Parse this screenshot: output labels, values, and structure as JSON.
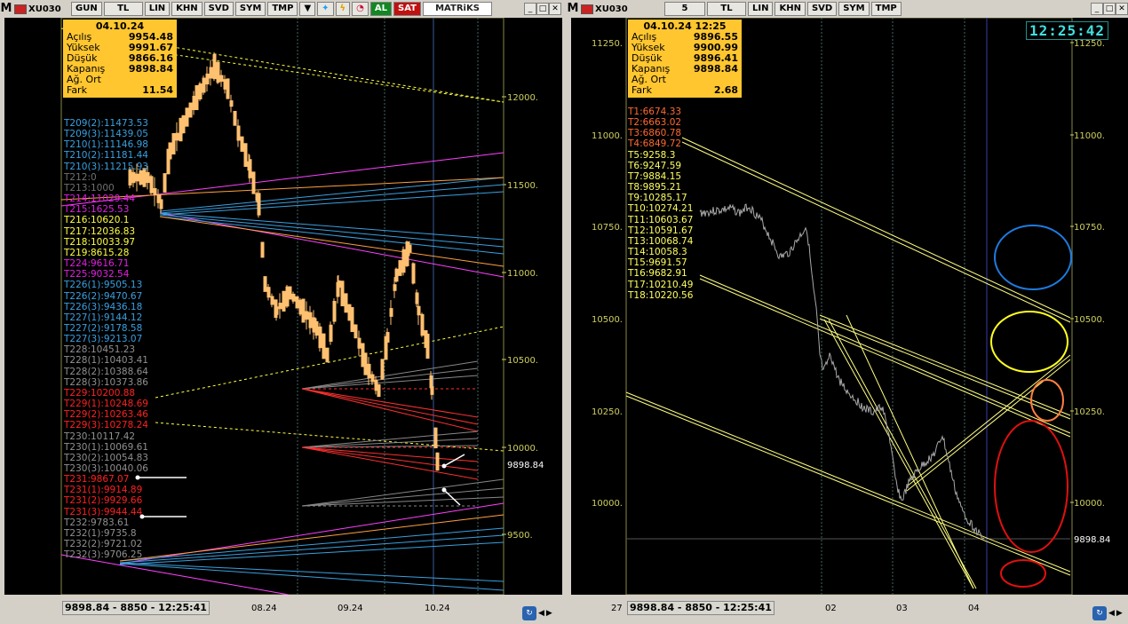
{
  "left": {
    "toolbar": {
      "m": "M",
      "symbol": "XU030",
      "period": "GUN",
      "currency": "TL",
      "btn_lin": "LIN",
      "btn_khn": "KHN",
      "btn_svd": "SVD",
      "btn_sym": "SYM",
      "btn_tmp": "TMP",
      "btn_al": "AL",
      "btn_sat": "SAT",
      "brand": "MATRiKS"
    },
    "ohlc": {
      "date": "04.10.24",
      "rows": [
        {
          "k": "Açılış",
          "v": "9954.48"
        },
        {
          "k": "Yüksek",
          "v": "9991.67"
        },
        {
          "k": "Düşük",
          "v": "9866.16"
        },
        {
          "k": "Kapanış",
          "v": "9898.84"
        },
        {
          "k": "Ağ. Ort",
          "v": ""
        },
        {
          "k": "Fark",
          "v": "11.54"
        }
      ]
    },
    "levels": [
      {
        "t": "T209(2):11473.53",
        "c": "#3aa0e0"
      },
      {
        "t": "T209(3):11439.05",
        "c": "#3aa0e0"
      },
      {
        "t": "T210(1):11146.98",
        "c": "#3aa0e0"
      },
      {
        "t": "T210(2):11181.44",
        "c": "#3aa0e0"
      },
      {
        "t": "T210(3):11215.93",
        "c": "#3aa0e0"
      },
      {
        "t": "T212:0",
        "c": "#707070"
      },
      {
        "t": "T213:1000",
        "c": "#707070"
      },
      {
        "t": "T214:11029.44",
        "c": "#e020e0"
      },
      {
        "t": "T215:1625.53",
        "c": "#e020e0"
      },
      {
        "t": "T216:10620.1",
        "c": "#ffff40"
      },
      {
        "t": "T217:12036.83",
        "c": "#ffff40"
      },
      {
        "t": "T218:10033.97",
        "c": "#ffff40"
      },
      {
        "t": "T219:8615.28",
        "c": "#ffff40"
      },
      {
        "t": "T224:9616.71",
        "c": "#e020e0"
      },
      {
        "t": "T225:9032.54",
        "c": "#e020e0"
      },
      {
        "t": "T226(1):9505.13",
        "c": "#3aa0e0"
      },
      {
        "t": "T226(2):9470.67",
        "c": "#3aa0e0"
      },
      {
        "t": "T226(3):9436.18",
        "c": "#3aa0e0"
      },
      {
        "t": "T227(1):9144.12",
        "c": "#3aa0e0"
      },
      {
        "t": "T227(2):9178.58",
        "c": "#3aa0e0"
      },
      {
        "t": "T227(3):9213.07",
        "c": "#3aa0e0"
      },
      {
        "t": "T228:10451.23",
        "c": "#909090"
      },
      {
        "t": "T228(1):10403.41",
        "c": "#909090"
      },
      {
        "t": "T228(2):10388.64",
        "c": "#909090"
      },
      {
        "t": "T228(3):10373.86",
        "c": "#909090"
      },
      {
        "t": "T229:10200.88",
        "c": "#ff2020"
      },
      {
        "t": "T229(1):10248.69",
        "c": "#ff2020"
      },
      {
        "t": "T229(2):10263.46",
        "c": "#ff2020"
      },
      {
        "t": "T229(3):10278.24",
        "c": "#ff2020"
      },
      {
        "t": "T230:10117.42",
        "c": "#909090"
      },
      {
        "t": "T230(1):10069.61",
        "c": "#909090"
      },
      {
        "t": "T230(2):10054.83",
        "c": "#909090"
      },
      {
        "t": "T230(3):10040.06",
        "c": "#909090"
      },
      {
        "t": "T231:9867.07",
        "c": "#ff2020"
      },
      {
        "t": "T231(1):9914.89",
        "c": "#ff2020"
      },
      {
        "t": "T231(2):9929.66",
        "c": "#ff2020"
      },
      {
        "t": "T231(3):9944.44",
        "c": "#ff2020"
      },
      {
        "t": "T232:9783.61",
        "c": "#909090"
      },
      {
        "t": "T232(1):9735.8",
        "c": "#909090"
      },
      {
        "t": "T232(2):9721.02",
        "c": "#909090"
      },
      {
        "t": "T232(3):9706.25",
        "c": "#909090"
      }
    ],
    "yaxis": [
      "12000.",
      "11500.",
      "11000.",
      "10500.",
      "10000.",
      "9500."
    ],
    "last_price": "9898.84",
    "status": "9898.84 - 8850 - 12:25:41",
    "xticks": [
      "08.24",
      "09.24",
      "10.24"
    ]
  },
  "right": {
    "toolbar": {
      "m": "M",
      "symbol": "XU030",
      "period": "5",
      "currency": "TL",
      "btn_lin": "LIN",
      "btn_khn": "KHN",
      "btn_svd": "SVD",
      "btn_sym": "SYM",
      "btn_tmp": "TMP"
    },
    "clock": "12:25:42",
    "ohlc": {
      "date": "04.10.24 12:25",
      "rows": [
        {
          "k": "Açılış",
          "v": "9896.55"
        },
        {
          "k": "Yüksek",
          "v": "9900.99"
        },
        {
          "k": "Düşük",
          "v": "9896.41"
        },
        {
          "k": "Kapanış",
          "v": "9898.84"
        },
        {
          "k": "Ağ. Ort",
          "v": ""
        },
        {
          "k": "Fark",
          "v": "2.68"
        }
      ]
    },
    "levels": [
      {
        "t": "T1:6674.33",
        "c": "#ff6a30"
      },
      {
        "t": "T2:6663.02",
        "c": "#ff6a30"
      },
      {
        "t": "T3:6860.78",
        "c": "#ff6a30"
      },
      {
        "t": "T4:6849.72",
        "c": "#ff6a30"
      },
      {
        "t": "T5:9258.3",
        "c": "#ffff60"
      },
      {
        "t": "T6:9247.59",
        "c": "#ffff60"
      },
      {
        "t": "T7:9884.15",
        "c": "#ffff60"
      },
      {
        "t": "T8:9895.21",
        "c": "#ffff60"
      },
      {
        "t": "T9:10285.17",
        "c": "#ffff60"
      },
      {
        "t": "T10:10274.21",
        "c": "#ffff60"
      },
      {
        "t": "T11:10603.67",
        "c": "#ffff60"
      },
      {
        "t": "T12:10591.67",
        "c": "#ffff60"
      },
      {
        "t": "T13:10068.74",
        "c": "#ffff60"
      },
      {
        "t": "T14:10058.3",
        "c": "#ffff60"
      },
      {
        "t": "T15:9691.57",
        "c": "#ffff60"
      },
      {
        "t": "T16:9682.91",
        "c": "#ffff60"
      },
      {
        "t": "T17:10210.49",
        "c": "#ffff60"
      },
      {
        "t": "T18:10220.56",
        "c": "#ffff60"
      }
    ],
    "yaxis_left": [
      "11250.",
      "11000.",
      "10750.",
      "10500.",
      "10250.",
      "10000."
    ],
    "yaxis_right": [
      "11250.",
      "11000.",
      "10750.",
      "10500.",
      "10250.",
      "10000."
    ],
    "last_price": "9898.84",
    "status": "9898.84 - 8850 - 12:25:41",
    "xticks": [
      "27",
      "02",
      "03",
      "04"
    ]
  }
}
